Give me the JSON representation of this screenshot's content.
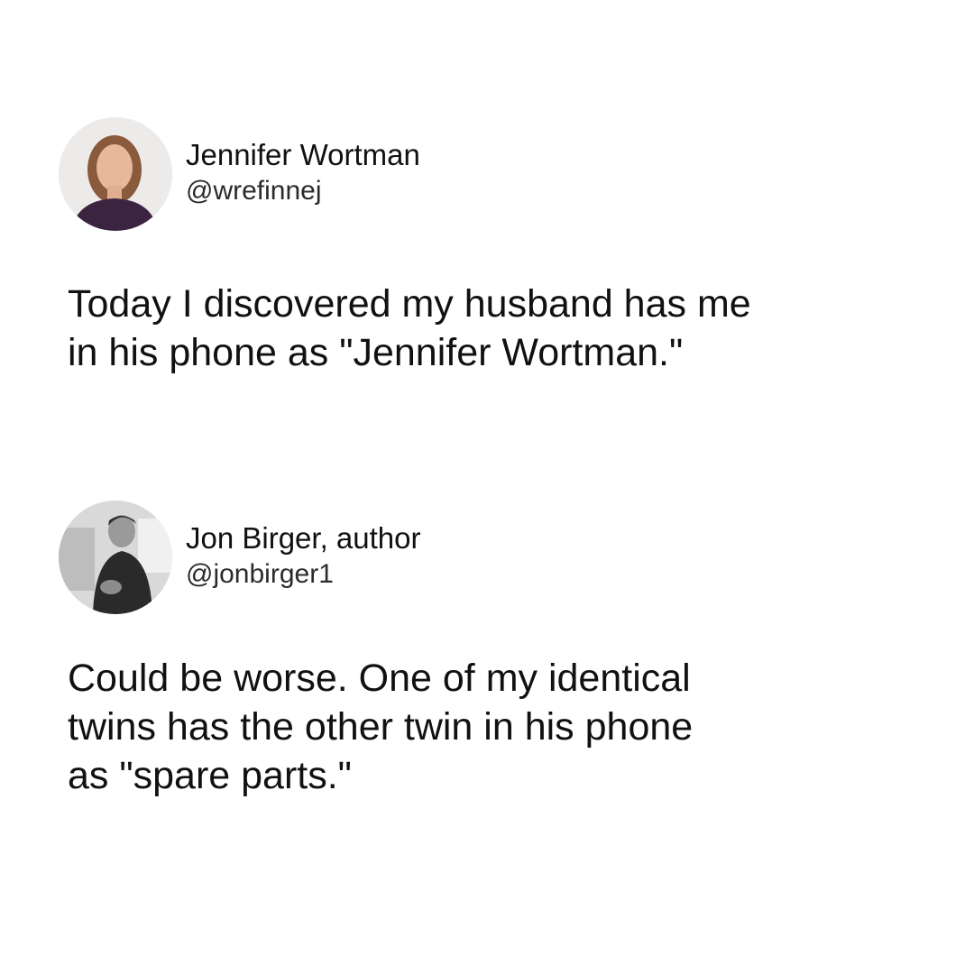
{
  "tweets": [
    {
      "display_name": "Jennifer Wortman",
      "handle": "@wrefinnej",
      "avatar_icon": "person-portrait-avatar",
      "text_lines": [
        "Today I discovered my husband has me",
        "in his phone as \"Jennifer Wortman.\""
      ]
    },
    {
      "display_name": "Jon Birger, author",
      "handle": "@jonbirger1",
      "avatar_icon": "person-portrait-avatar",
      "text_lines": [
        "Could be worse. One of my identical",
        "twins has the other twin in his phone",
        "as \"spare parts.\""
      ]
    }
  ]
}
